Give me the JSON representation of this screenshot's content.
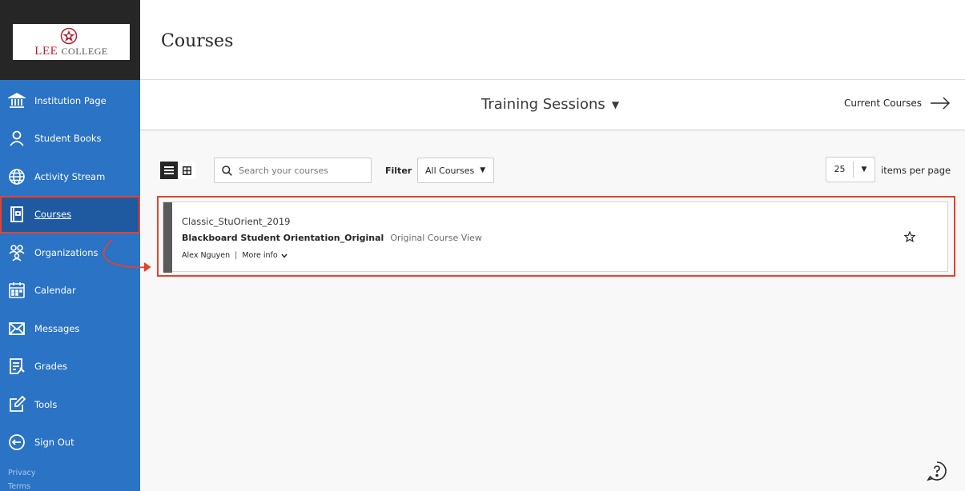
{
  "brand": {
    "logo_first": "Lee",
    "logo_second": "College"
  },
  "sidebar": {
    "items": [
      {
        "label": "Institution Page",
        "icon": "institution-icon"
      },
      {
        "label": "Student Books",
        "icon": "person-icon"
      },
      {
        "label": "Activity Stream",
        "icon": "globe-icon"
      },
      {
        "label": "Courses",
        "icon": "courses-icon",
        "active": true
      },
      {
        "label": "Organizations",
        "icon": "organizations-icon"
      },
      {
        "label": "Calendar",
        "icon": "calendar-icon"
      },
      {
        "label": "Messages",
        "icon": "envelope-icon"
      },
      {
        "label": "Grades",
        "icon": "grades-icon"
      },
      {
        "label": "Tools",
        "icon": "tools-icon"
      },
      {
        "label": "Sign Out",
        "icon": "sign-out-icon"
      }
    ],
    "footer": {
      "privacy": "Privacy",
      "terms": "Terms"
    }
  },
  "header": {
    "title": "Courses"
  },
  "subheader": {
    "session": "Training Sessions",
    "current_courses": "Current Courses"
  },
  "toolbar": {
    "search_placeholder": "Search your courses",
    "filter_label": "Filter",
    "filter_value": "All Courses",
    "per_page_value": "25",
    "per_page_label": "items per page"
  },
  "courses": [
    {
      "id": "Classic_StuOrient_2019",
      "name": "Blackboard Student Orientation_Original",
      "view": "Original Course View",
      "instructor": "Alex Nguyen",
      "separator": "|",
      "more_info": "More info"
    }
  ],
  "colors": {
    "sidebar": "#2a73c5",
    "sidebar_active": "#1f5aa0",
    "logo_bg": "#262626",
    "annotation": "#e8412a"
  }
}
